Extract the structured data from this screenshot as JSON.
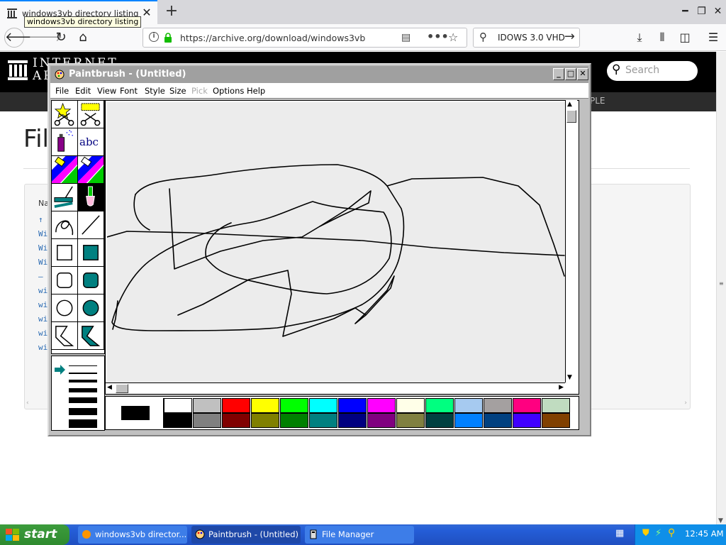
{
  "browser": {
    "tab_title": "windows3vb directory listing",
    "tooltip": "windows3vb directory listing",
    "url": "https://archive.org/download/windows3vb",
    "search_text": "IDOWS 3.0 VHD"
  },
  "page": {
    "logo_line1": "INTERNET",
    "logo_line2": "AR",
    "search_placeholder": "Search",
    "heading_partial": "Fil",
    "nav_partial": "PLE",
    "name_header_partial": "Na",
    "links": [
      "↑",
      "Wi",
      "Wi",
      "Wi",
      "—",
      "wi",
      "wi",
      "wi",
      "wi",
      "wi"
    ]
  },
  "paintbrush": {
    "title": "Paintbrush - (Untitled)",
    "menu": [
      "File",
      "Edit",
      "View",
      "Font",
      "Style",
      "Size",
      "Pick",
      "Options",
      "Help"
    ],
    "disabled_menu": [
      "Pick"
    ],
    "tools": [
      "scissors-star",
      "scissors-rect",
      "spray-can",
      "text-tool",
      "color-eraser",
      "eraser",
      "paint-roller",
      "brush",
      "curve",
      "line",
      "box",
      "filled-box",
      "rounded-box",
      "filled-rounded-box",
      "circle",
      "filled-circle",
      "polygon",
      "filled-polygon"
    ],
    "text_tool_label": "abc",
    "palette_top": [
      "#ffffff",
      "#c0c0c0",
      "#ff0000",
      "#ffff00",
      "#00ff00",
      "#00ffff",
      "#0000ff",
      "#ff00ff",
      "#ffffe8",
      "#00ff80",
      "#a6caf0",
      "#a4a0a0",
      "#ff0080",
      "#c0dcc0"
    ],
    "palette_bottom": [
      "#000000",
      "#808080",
      "#800000",
      "#808000",
      "#008000",
      "#008080",
      "#000080",
      "#800080",
      "#808040",
      "#004040",
      "#0080ff",
      "#004080",
      "#4000ff",
      "#804000"
    ],
    "foreground": "#000000",
    "background": "#ffffff"
  },
  "taskbar": {
    "start": "start",
    "items": [
      "windows3vb director...",
      "Paintbrush - (Untitled)",
      "File Manager"
    ],
    "clock": "12:45 AM"
  }
}
